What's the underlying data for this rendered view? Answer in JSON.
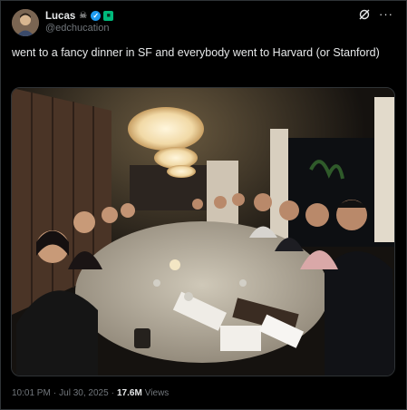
{
  "author": {
    "display_name": "Lucas",
    "handle": "@edchucation",
    "badges": [
      "skull-crossbones-icon",
      "verified-icon",
      "green-square-icon"
    ]
  },
  "header_icons": [
    "grok-icon",
    "more-icon"
  ],
  "tweet": {
    "text": "went to a fancy dinner in SF and everybody went to Harvard (or Stanford)"
  },
  "media": {
    "type": "photo",
    "description_icon": "group-dinner-photo"
  },
  "meta": {
    "time": "10:01 PM",
    "separator": "·",
    "date": "Jul 30, 2025",
    "views_count": "17.6M",
    "views_label": "Views"
  },
  "colors": {
    "background": "#000000",
    "text": "#e7e9ea",
    "muted": "#71767b",
    "verified": "#1d9bf0",
    "border": "#2f3336"
  }
}
